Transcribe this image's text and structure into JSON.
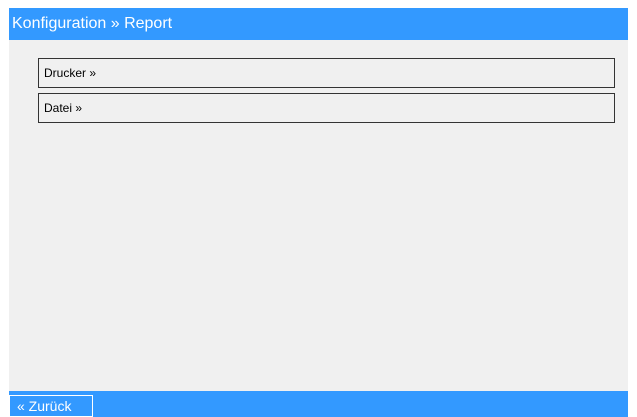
{
  "header": {
    "title": "Konfiguration » Report"
  },
  "menu": {
    "items": [
      {
        "label": "Drucker »"
      },
      {
        "label": "Datei »"
      }
    ]
  },
  "footer": {
    "back_label": "« Zurück"
  },
  "colors": {
    "accent": "#3399ff",
    "background": "#f0f0f0",
    "border": "#333333"
  }
}
